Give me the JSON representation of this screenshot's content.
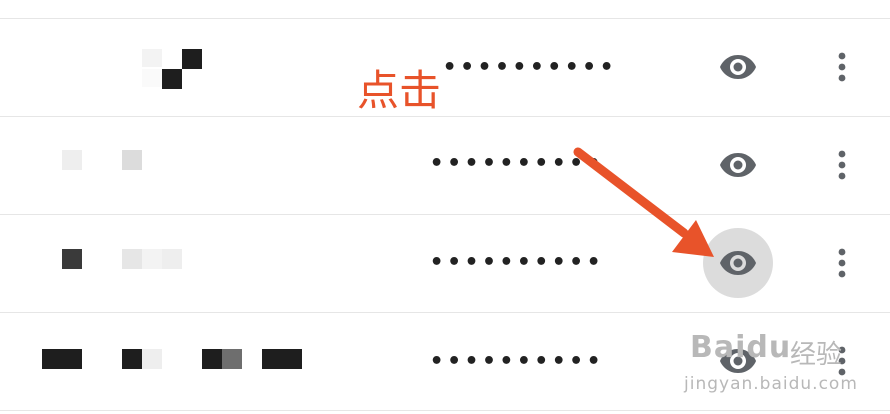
{
  "password_list": {
    "rows": [
      {
        "masked_password": "••••••••••",
        "reveal_icon": "eye-icon",
        "menu_icon": "more-vert-icon"
      },
      {
        "masked_password": "••••••••••",
        "reveal_icon": "eye-icon",
        "menu_icon": "more-vert-icon"
      },
      {
        "masked_password": "••••••••••",
        "reveal_icon": "eye-icon",
        "menu_icon": "more-vert-icon",
        "pressed": true
      },
      {
        "masked_password": "••••••••••",
        "reveal_icon": "eye-icon",
        "menu_icon": "more-vert-icon"
      }
    ]
  },
  "annotation": {
    "label": "点击",
    "color": "#e8532a"
  },
  "watermark": {
    "brand": "Baidu",
    "name_cn": "经验",
    "url": "jingyan.baidu.com"
  },
  "colors": {
    "icon": "#5f6368",
    "pressed_bg": "#dcdcdc",
    "divider": "#e6e6e6"
  }
}
